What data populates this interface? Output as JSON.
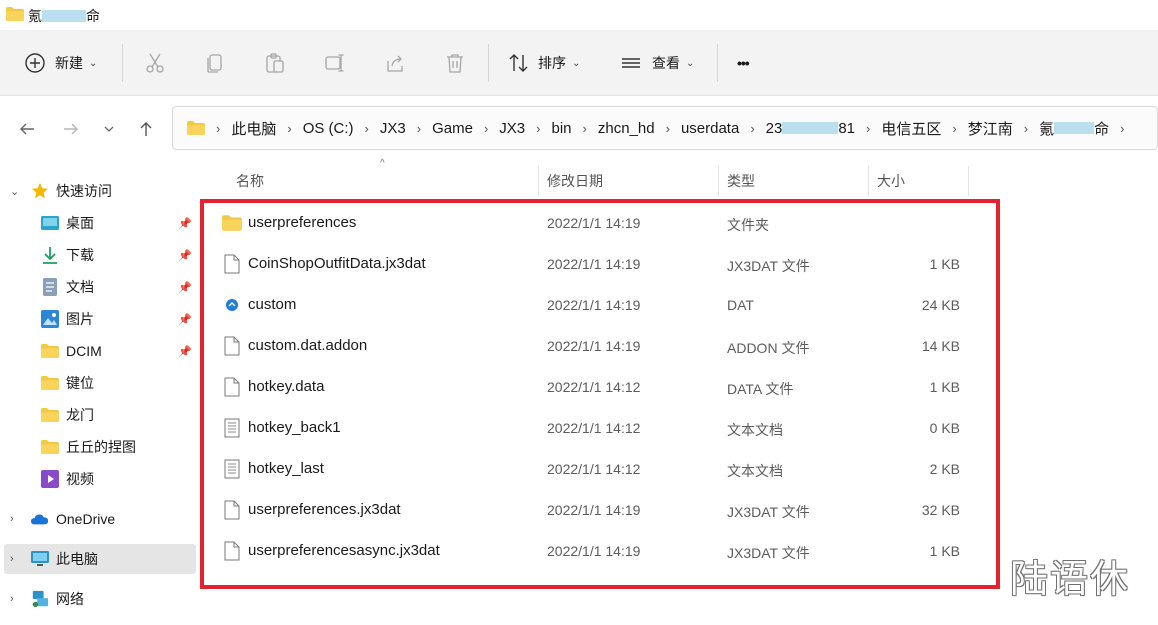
{
  "window": {
    "title_prefix": "氪",
    "title_suffix": "命"
  },
  "toolbar": {
    "new_label": "新建",
    "sort_label": "排序",
    "view_label": "查看",
    "more_label": "•••",
    "icons": [
      "cut-icon",
      "copy-icon",
      "paste-icon",
      "rename-icon",
      "share-icon",
      "delete-icon"
    ]
  },
  "breadcrumb": {
    "items": [
      "此电脑",
      "OS (C:)",
      "JX3",
      "Game",
      "JX3",
      "bin",
      "zhcn_hd",
      "userdata"
    ],
    "account_prefix": "23",
    "account_suffix": "81",
    "items_after": [
      "电信五区",
      "梦江南"
    ],
    "last_prefix": "氪",
    "last_suffix": "命"
  },
  "sidebar": {
    "quick_access": "快速访问",
    "items": [
      {
        "label": "桌面",
        "icon": "desktop-icon",
        "pinned": true
      },
      {
        "label": "下载",
        "icon": "download-icon",
        "pinned": true
      },
      {
        "label": "文档",
        "icon": "document-icon",
        "pinned": true
      },
      {
        "label": "图片",
        "icon": "picture-icon",
        "pinned": true
      },
      {
        "label": "DCIM",
        "icon": "folder-icon",
        "pinned": true
      },
      {
        "label": "键位",
        "icon": "folder-icon",
        "pinned": false
      },
      {
        "label": "龙门",
        "icon": "folder-icon",
        "pinned": false
      },
      {
        "label": "丘丘的捏图",
        "icon": "folder-icon",
        "pinned": false
      },
      {
        "label": "视频",
        "icon": "video-icon",
        "pinned": false
      }
    ],
    "onedrive": "OneDrive",
    "this_pc": "此电脑",
    "network": "网络"
  },
  "columns": {
    "name": "名称",
    "date": "修改日期",
    "type": "类型",
    "size": "大小"
  },
  "files": [
    {
      "name": "userpreferences",
      "date": "2022/1/1 14:19",
      "type": "文件夹",
      "size": "",
      "icon": "folder-icon"
    },
    {
      "name": "CoinShopOutfitData.jx3dat",
      "date": "2022/1/1 14:19",
      "type": "JX3DAT 文件",
      "size": "1 KB",
      "icon": "file-icon"
    },
    {
      "name": "custom",
      "date": "2022/1/1 14:19",
      "type": "DAT",
      "size": "24 KB",
      "icon": "app-icon"
    },
    {
      "name": "custom.dat.addon",
      "date": "2022/1/1 14:19",
      "type": "ADDON 文件",
      "size": "14 KB",
      "icon": "file-icon"
    },
    {
      "name": "hotkey.data",
      "date": "2022/1/1 14:12",
      "type": "DATA 文件",
      "size": "1 KB",
      "icon": "file-icon"
    },
    {
      "name": "hotkey_back1",
      "date": "2022/1/1 14:12",
      "type": "文本文档",
      "size": "0 KB",
      "icon": "text-file-icon"
    },
    {
      "name": "hotkey_last",
      "date": "2022/1/1 14:12",
      "type": "文本文档",
      "size": "2 KB",
      "icon": "text-file-icon"
    },
    {
      "name": "userpreferences.jx3dat",
      "date": "2022/1/1 14:19",
      "type": "JX3DAT 文件",
      "size": "32 KB",
      "icon": "file-icon"
    },
    {
      "name": "userpreferencesasync.jx3dat",
      "date": "2022/1/1 14:19",
      "type": "JX3DAT 文件",
      "size": "1 KB",
      "icon": "file-icon"
    }
  ],
  "watermark": "陆语休",
  "colors": {
    "highlight": "#e52232",
    "folder": "#f2c744",
    "accent": "#1f7fd6"
  }
}
